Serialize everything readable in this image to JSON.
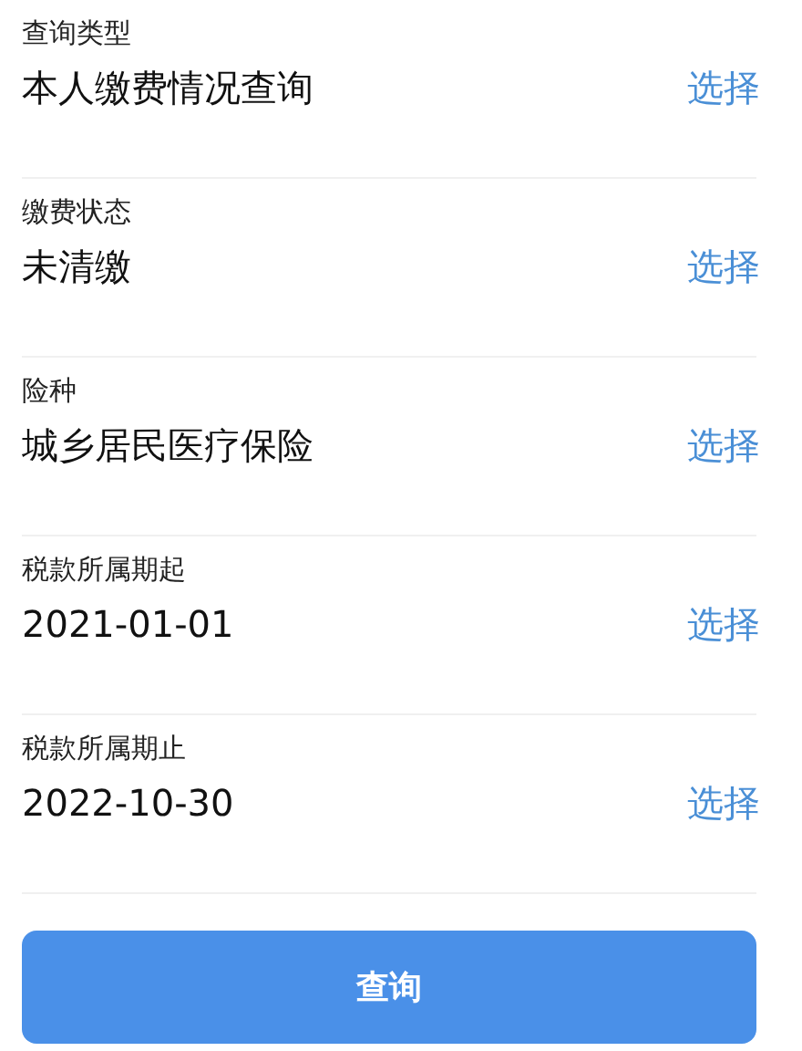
{
  "fields": [
    {
      "label": "查询类型",
      "value": "本人缴费情况查询",
      "action": "选择"
    },
    {
      "label": "缴费状态",
      "value": "未清缴",
      "action": "选择"
    },
    {
      "label": "险种",
      "value": "城乡居民医疗保险",
      "action": "选择"
    },
    {
      "label": "税款所属期起",
      "value": "2021-01-01",
      "action": "选择"
    },
    {
      "label": "税款所属期止",
      "value": "2022-10-30",
      "action": "选择"
    }
  ],
  "submit": {
    "label": "查询"
  }
}
